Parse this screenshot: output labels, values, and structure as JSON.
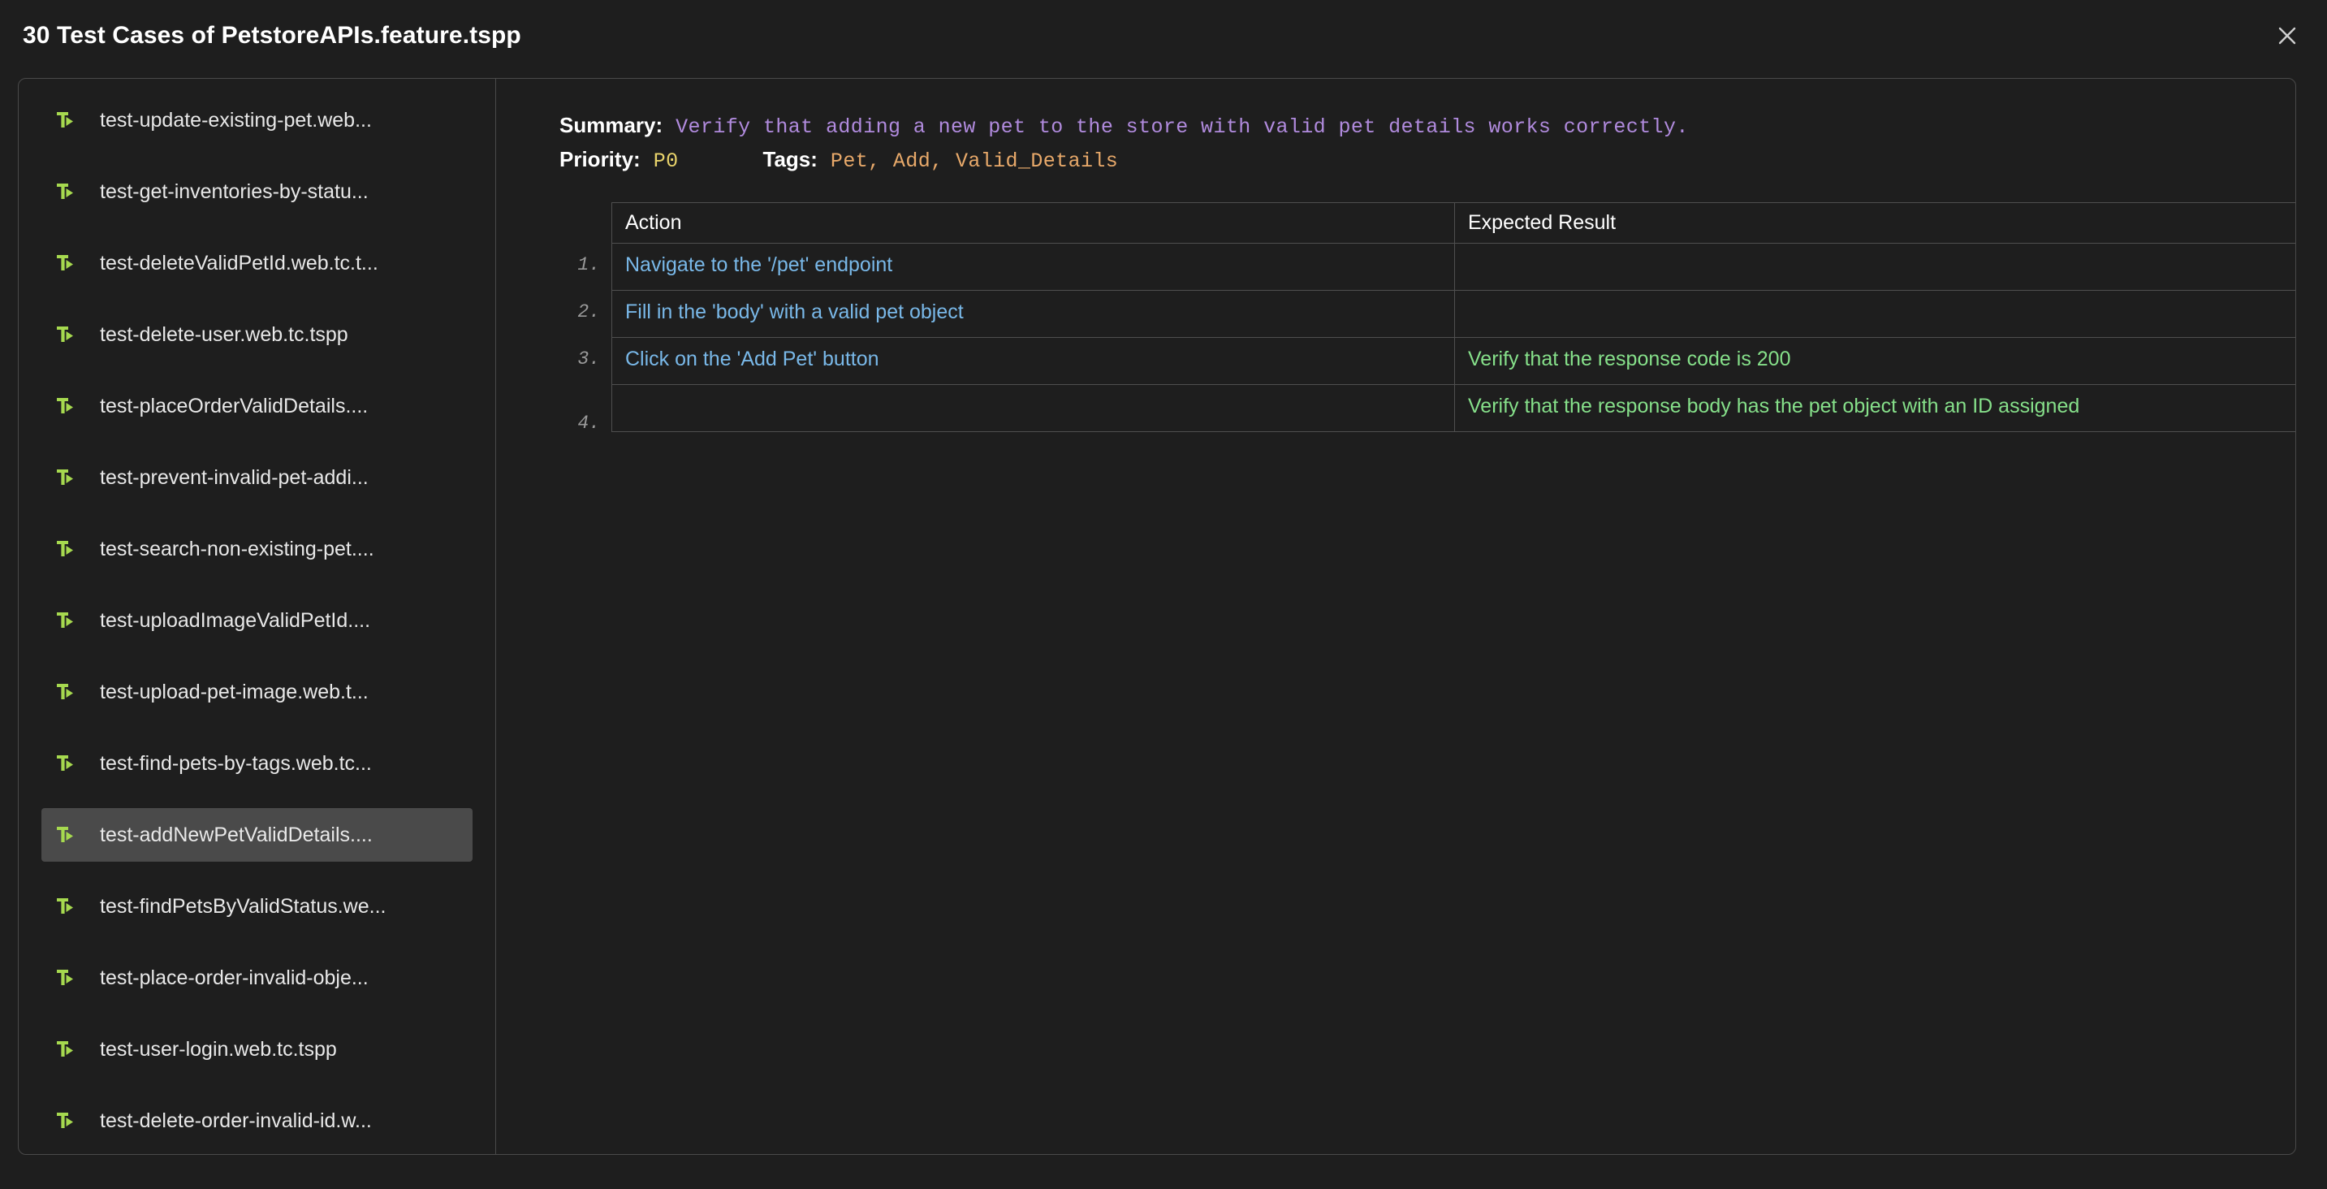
{
  "window": {
    "title": "30 Test Cases of PetstoreAPIs.feature.tspp",
    "close_icon": "close-icon"
  },
  "sidebar": {
    "items": [
      {
        "icon": "test-case-icon",
        "label": "test-update-existing-pet.web...",
        "selected": false
      },
      {
        "icon": "test-case-icon",
        "label": "test-get-inventories-by-statu...",
        "selected": false
      },
      {
        "icon": "test-case-icon",
        "label": "test-deleteValidPetId.web.tc.t...",
        "selected": false
      },
      {
        "icon": "test-case-icon",
        "label": "test-delete-user.web.tc.tspp",
        "selected": false
      },
      {
        "icon": "test-case-icon",
        "label": "test-placeOrderValidDetails....",
        "selected": false
      },
      {
        "icon": "test-case-icon",
        "label": "test-prevent-invalid-pet-addi...",
        "selected": false
      },
      {
        "icon": "test-case-icon",
        "label": "test-search-non-existing-pet....",
        "selected": false
      },
      {
        "icon": "test-case-icon",
        "label": "test-uploadImageValidPetId....",
        "selected": false
      },
      {
        "icon": "test-case-icon",
        "label": "test-upload-pet-image.web.t...",
        "selected": false
      },
      {
        "icon": "test-case-icon",
        "label": "test-find-pets-by-tags.web.tc...",
        "selected": false
      },
      {
        "icon": "test-case-icon",
        "label": "test-addNewPetValidDetails....",
        "selected": true
      },
      {
        "icon": "test-case-icon",
        "label": "test-findPetsByValidStatus.we...",
        "selected": false
      },
      {
        "icon": "test-case-icon",
        "label": "test-place-order-invalid-obje...",
        "selected": false
      },
      {
        "icon": "test-case-icon",
        "label": "test-user-login.web.tc.tspp",
        "selected": false
      },
      {
        "icon": "test-case-icon",
        "label": "test-delete-order-invalid-id.w...",
        "selected": false
      }
    ]
  },
  "detail": {
    "summary_label": "Summary:",
    "summary_value": "Verify that adding a new pet to the store with valid pet details works correctly.",
    "priority_label": "Priority:",
    "priority_value": "P0",
    "tags_label": "Tags:",
    "tags_value": "Pet, Add, Valid_Details",
    "table": {
      "headers": [
        "Action",
        "Expected Result"
      ],
      "rows": [
        {
          "num": "1.",
          "action": "Navigate to the '/pet' endpoint",
          "expected": ""
        },
        {
          "num": "2.",
          "action": "Fill in the 'body' with a valid pet object",
          "expected": ""
        },
        {
          "num": "3.",
          "action": "Click on the 'Add Pet' button",
          "expected": "Verify that the response code is 200"
        },
        {
          "num": "4.",
          "action": "",
          "expected": "Verify that the response body has the pet object with an ID assigned"
        }
      ]
    }
  },
  "colors": {
    "background": "#1e1e1e",
    "panel_border": "#4a4a4a",
    "selected_row": "#4a4a4a",
    "icon_green": "#a6d94f",
    "summary_purple": "#b18bde",
    "priority_yellow": "#e8d36b",
    "tags_orange": "#e8a96a",
    "action_blue": "#79b8e8",
    "expected_green": "#86e08a"
  }
}
